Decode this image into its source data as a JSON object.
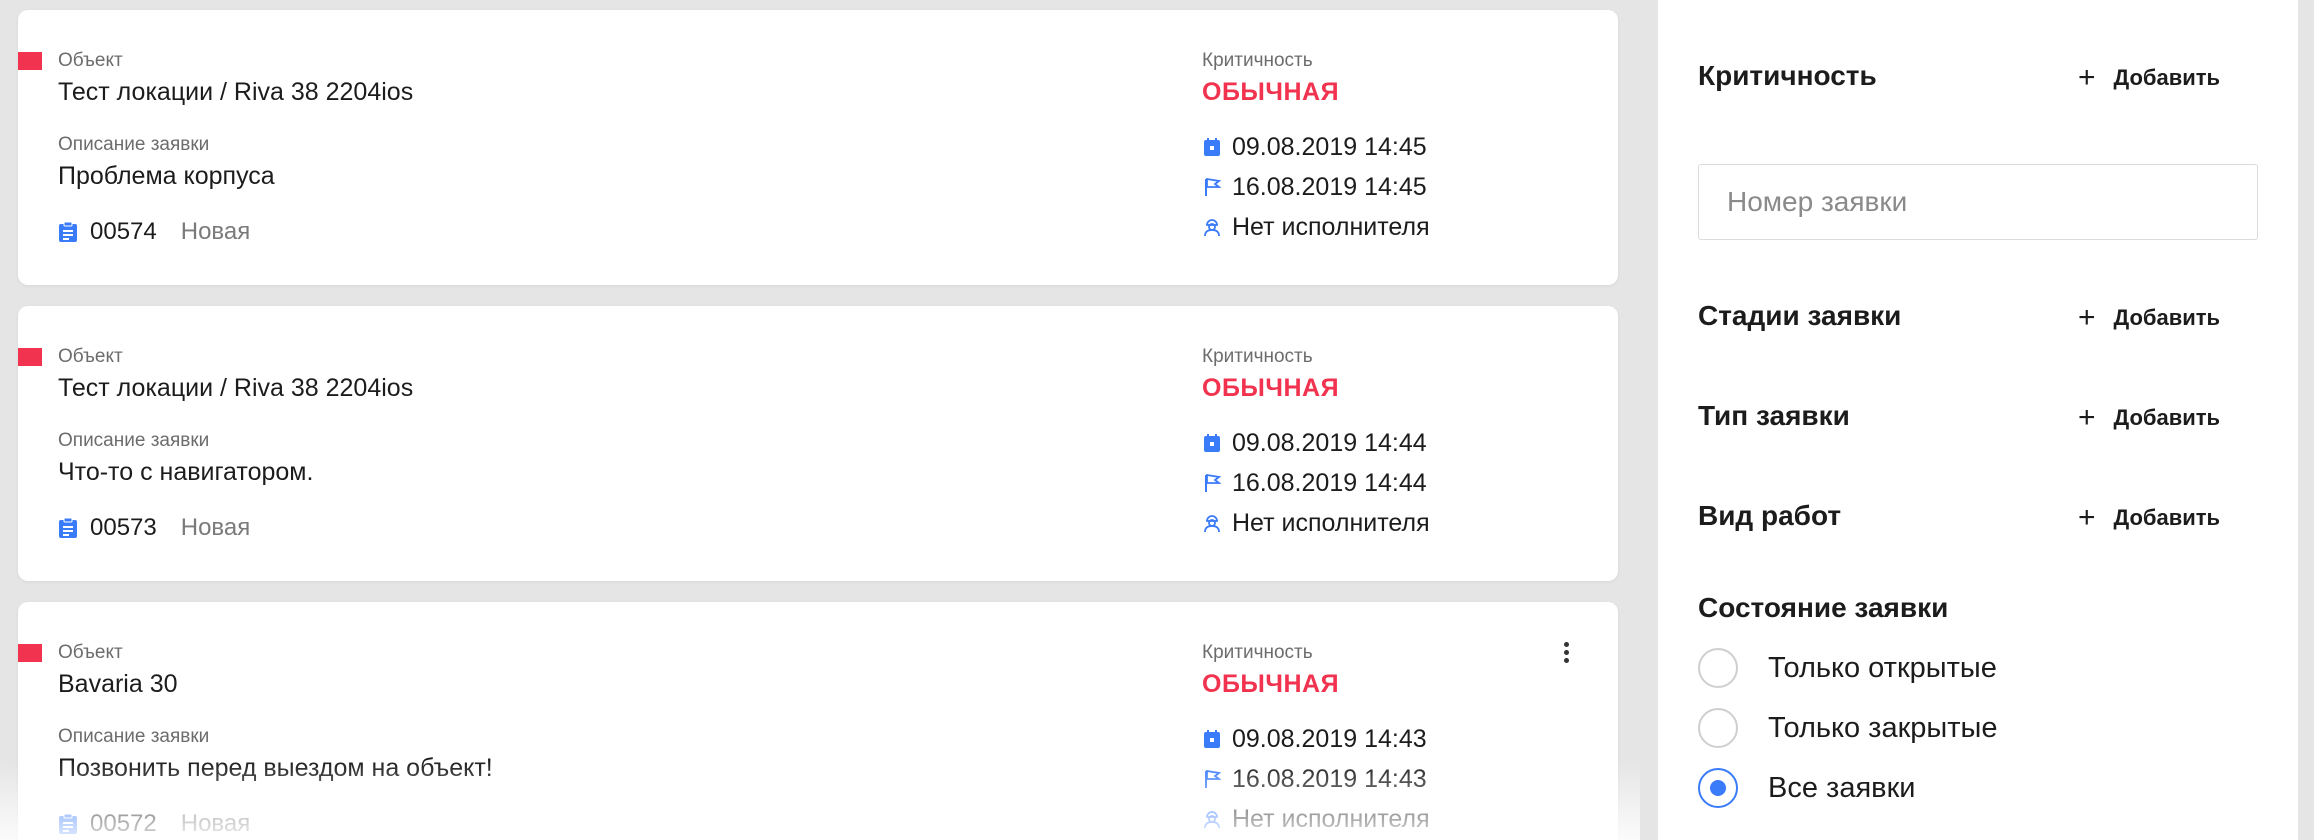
{
  "labels": {
    "object": "Объект",
    "description": "Описание заявки",
    "criticality": "Критичность"
  },
  "tickets": [
    {
      "object": "Тест локации / Riva 38 2204ios",
      "description": "Проблема корпуса",
      "number": "00574",
      "status": "Новая",
      "criticality": "ОБЫЧНАЯ",
      "created": "09.08.2019 14:45",
      "deadline": "16.08.2019 14:45",
      "assignee": "Нет исполнителя"
    },
    {
      "object": "Тест локации / Riva 38 2204ios",
      "description": "Что-то с навигатором.",
      "number": "00573",
      "status": "Новая",
      "criticality": "ОБЫЧНАЯ",
      "created": "09.08.2019 14:44",
      "deadline": "16.08.2019 14:44",
      "assignee": "Нет исполнителя"
    },
    {
      "object": "Bavaria 30",
      "description": "Позвонить перед выездом на объект!",
      "number": "00572",
      "status": "Новая",
      "criticality": "ОБЫЧНАЯ",
      "created": "09.08.2019 14:43",
      "deadline": "16.08.2019 14:43",
      "assignee": "Нет исполнителя"
    }
  ],
  "filters": {
    "criticality_title": "Критичность",
    "add_label": "Добавить",
    "search_placeholder": "Номер заявки",
    "stages_title": "Стадии заявки",
    "type_title": "Тип заявки",
    "work_title": "Вид работ",
    "state_title": "Состояние заявки",
    "state_options": [
      "Только открытые",
      "Только закрытые",
      "Все заявки"
    ],
    "state_selected": "Все заявки"
  },
  "colors": {
    "accent_red": "#f1334f",
    "accent_blue": "#3a7bfa"
  },
  "icons": {
    "number": "clipboard-icon",
    "created": "calendar-icon",
    "deadline": "flag-icon",
    "assignee": "worker-icon",
    "menu": "kebab-menu-icon",
    "add": "plus-icon"
  }
}
